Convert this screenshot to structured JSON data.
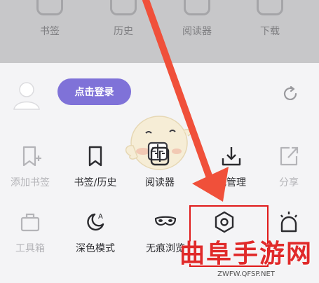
{
  "top_bar": {
    "items": [
      {
        "label": "书签",
        "icon": "bookmark-icon"
      },
      {
        "label": "历史",
        "icon": "clock-icon"
      },
      {
        "label": "阅读器",
        "icon": "book-icon"
      },
      {
        "label": "下载",
        "icon": "download-icon"
      }
    ]
  },
  "account": {
    "login_label": "点击登录",
    "avatar_icon": "user-avatar-icon",
    "refresh_icon": "refresh-icon"
  },
  "menu_row1": [
    {
      "label": "添加书签",
      "icon": "bookmark-add-icon",
      "enabled": false
    },
    {
      "label": "书签/历史",
      "icon": "bookmark-icon",
      "enabled": true
    },
    {
      "label": "阅读器",
      "icon": "reader-icon",
      "enabled": true
    },
    {
      "label": "载管理",
      "icon": "download-manage-icon",
      "enabled": true
    },
    {
      "label": "分享",
      "icon": "share-icon",
      "enabled": false
    }
  ],
  "menu_row2": [
    {
      "label": "工具箱",
      "icon": "toolbox-icon",
      "enabled": false
    },
    {
      "label": "深色模式",
      "icon": "dark-mode-icon",
      "enabled": true
    },
    {
      "label": "无痕浏览",
      "icon": "incognito-mask-icon",
      "enabled": true
    },
    {
      "label": "",
      "icon": "settings-hexagon-icon",
      "enabled": true
    },
    {
      "label": "",
      "icon": "notification-bell-icon",
      "enabled": true
    }
  ],
  "annotation": {
    "arrow_color": "#f0503a",
    "box_color": "#e01a1a"
  },
  "watermark": {
    "main": "曲阜手游网",
    "url": "ZWFW.QFSP.NET"
  },
  "colors": {
    "accent": "#7f72d8",
    "text_dark": "#2b2b2f",
    "text_muted": "#b4b4b8",
    "background": "#f4f4f6"
  }
}
